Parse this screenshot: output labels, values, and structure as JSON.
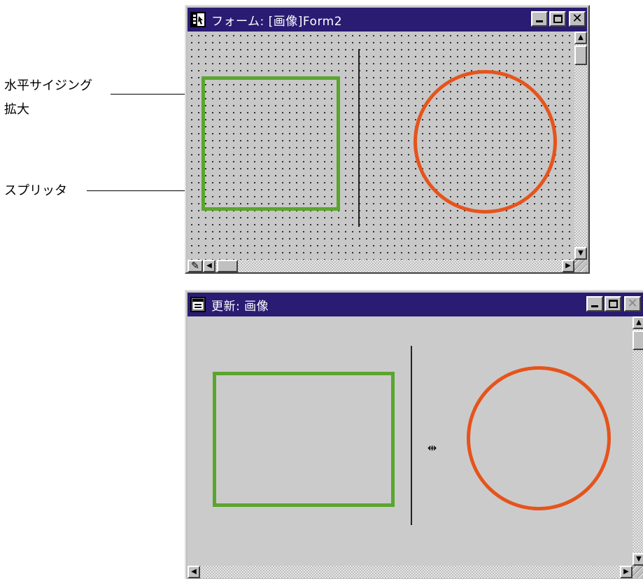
{
  "annotations": {
    "horizontal_sizing": "水平サイジング",
    "enlarge": "拡大",
    "splitter": "スプリッタ"
  },
  "window1": {
    "title": "フォーム: [画像]Form2",
    "buttons": {
      "minimize": "_",
      "maximize": "□",
      "close": "✕"
    },
    "scroll_glyphs": {
      "up": "▲",
      "down": "▼",
      "left": "◀",
      "right": "▶"
    },
    "status_icon": "✎"
  },
  "window2": {
    "title": "更新: 画像",
    "buttons": {
      "minimize": "_",
      "maximize": "□",
      "close": "✕"
    },
    "scroll_glyphs": {
      "up": "▲",
      "down": "▼",
      "left": "◀",
      "right": "▶"
    },
    "cursor_glyph": "⇹"
  },
  "colors": {
    "title_bar": "#2a1b73",
    "rectangle_stroke": "#5ba52e",
    "circle_stroke": "#e5541c",
    "splitter": "#222222"
  },
  "icons": {
    "form_window": "form-icon",
    "run_window": "window-icon",
    "pencil": "pencil-icon",
    "resize_cursor": "split-cursor-icon"
  }
}
